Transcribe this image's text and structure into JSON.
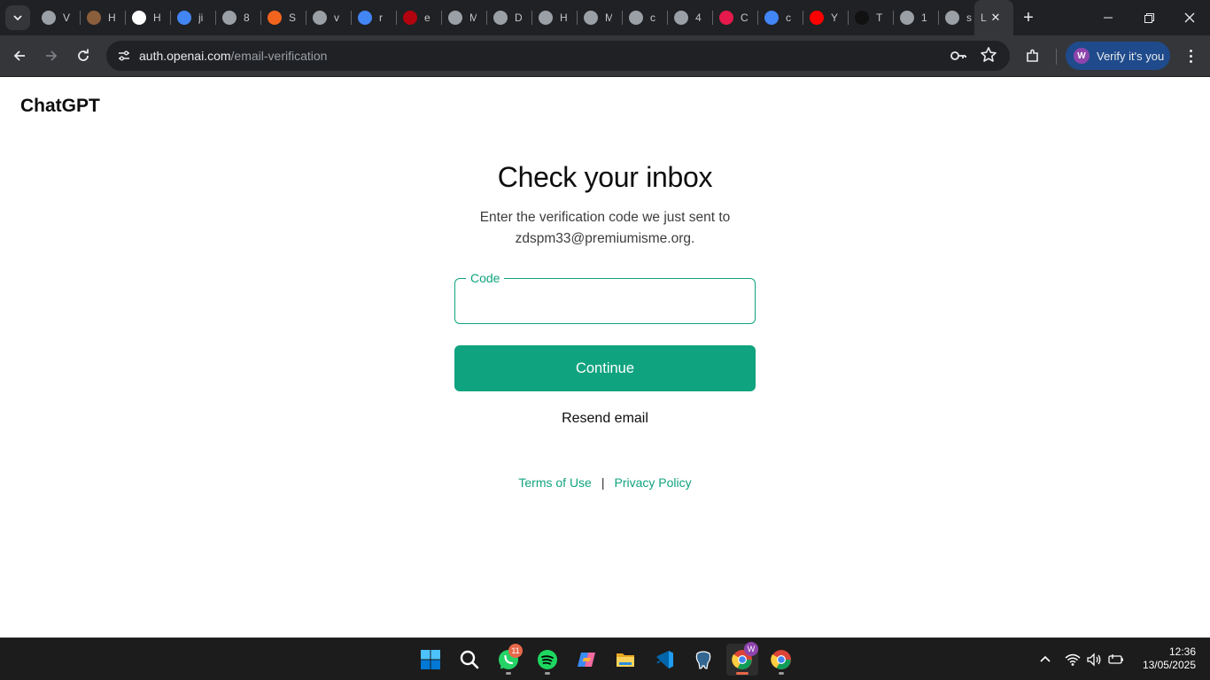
{
  "browser": {
    "tabs": [
      {
        "title": "V",
        "favicon": "chrome-icon",
        "color": "#9aa0a6"
      },
      {
        "title": "H",
        "favicon": "app-icon",
        "color": "#8b5e3c"
      },
      {
        "title": "H",
        "favicon": "openai-icon",
        "color": "#ffffff"
      },
      {
        "title": "ji",
        "favicon": "google-icon",
        "color": "#4285f4"
      },
      {
        "title": "8",
        "favicon": "globe-icon",
        "color": "#9aa0a6"
      },
      {
        "title": "S",
        "favicon": "etsy-icon",
        "color": "#f1641e"
      },
      {
        "title": "v",
        "favicon": "globe-icon",
        "color": "#9aa0a6"
      },
      {
        "title": "r",
        "favicon": "google-icon",
        "color": "#4285f4"
      },
      {
        "title": "e",
        "favicon": "stanford-icon",
        "color": "#b1040e"
      },
      {
        "title": "M",
        "favicon": "chrome-icon",
        "color": "#9aa0a6"
      },
      {
        "title": "D",
        "favicon": "globe-icon",
        "color": "#9aa0a6"
      },
      {
        "title": "H",
        "favicon": "globe-icon",
        "color": "#9aa0a6"
      },
      {
        "title": "M",
        "favicon": "chrome-icon",
        "color": "#9aa0a6"
      },
      {
        "title": "c",
        "favicon": "globe-icon",
        "color": "#9aa0a6"
      },
      {
        "title": "4",
        "favicon": "globe-icon",
        "color": "#9aa0a6"
      },
      {
        "title": "C",
        "favicon": "y-icon",
        "color": "#e5194b"
      },
      {
        "title": "c",
        "favicon": "google-icon",
        "color": "#4285f4"
      },
      {
        "title": "Y",
        "favicon": "youtube-icon",
        "color": "#ff0000"
      },
      {
        "title": "T",
        "favicon": "tiktok-icon",
        "color": "#111111"
      },
      {
        "title": "1",
        "favicon": "globe-icon",
        "color": "#9aa0a6"
      },
      {
        "title": "s",
        "favicon": "globe-icon",
        "color": "#9aa0a6"
      }
    ],
    "active_tab_title": "L",
    "url_host": "auth.openai.com",
    "url_path": "/email-verification",
    "profile_label": "Verify it's you",
    "profile_initial": "W"
  },
  "page": {
    "brand": "ChatGPT",
    "heading": "Check your inbox",
    "subtext": "Enter the verification code we just sent to zdspm33@premiumisme.org.",
    "code_label": "Code",
    "code_value": "",
    "continue_label": "Continue",
    "resend_label": "Resend email",
    "terms_label": "Terms of Use",
    "divider": "|",
    "privacy_label": "Privacy Policy",
    "accent_color": "#10a37f"
  },
  "taskbar": {
    "apps": [
      "windows-start",
      "search",
      "whatsapp",
      "spotify",
      "copilot",
      "file-explorer",
      "vscode",
      "postgresql",
      "chrome-profile",
      "chrome"
    ],
    "whatsapp_badge": "11",
    "chrome_profile_initial": "W",
    "time": "12:36",
    "date": "13/05/2025"
  }
}
